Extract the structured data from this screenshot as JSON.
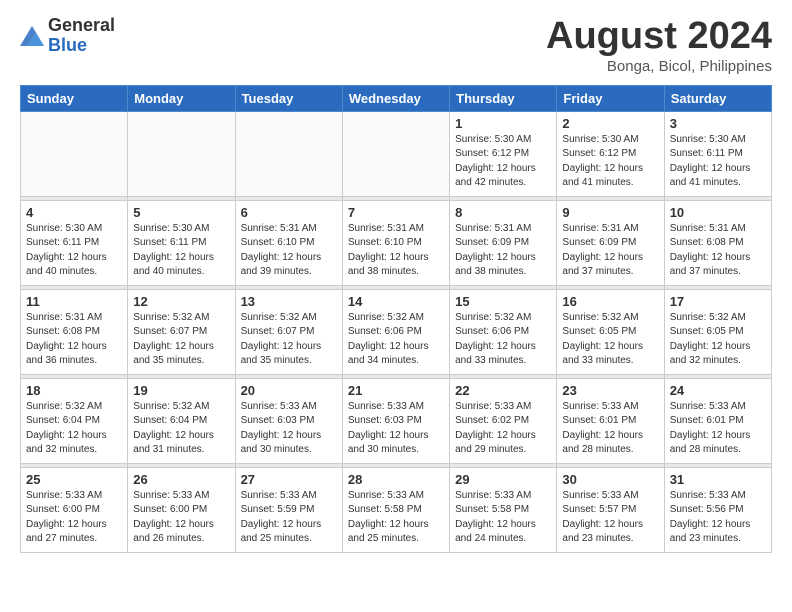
{
  "header": {
    "logo_general": "General",
    "logo_blue": "Blue",
    "month_year": "August 2024",
    "location": "Bonga, Bicol, Philippines"
  },
  "weekdays": [
    "Sunday",
    "Monday",
    "Tuesday",
    "Wednesday",
    "Thursday",
    "Friday",
    "Saturday"
  ],
  "weeks": [
    [
      {
        "day": "",
        "info": ""
      },
      {
        "day": "",
        "info": ""
      },
      {
        "day": "",
        "info": ""
      },
      {
        "day": "",
        "info": ""
      },
      {
        "day": "1",
        "info": "Sunrise: 5:30 AM\nSunset: 6:12 PM\nDaylight: 12 hours\nand 42 minutes."
      },
      {
        "day": "2",
        "info": "Sunrise: 5:30 AM\nSunset: 6:12 PM\nDaylight: 12 hours\nand 41 minutes."
      },
      {
        "day": "3",
        "info": "Sunrise: 5:30 AM\nSunset: 6:11 PM\nDaylight: 12 hours\nand 41 minutes."
      }
    ],
    [
      {
        "day": "4",
        "info": "Sunrise: 5:30 AM\nSunset: 6:11 PM\nDaylight: 12 hours\nand 40 minutes."
      },
      {
        "day": "5",
        "info": "Sunrise: 5:30 AM\nSunset: 6:11 PM\nDaylight: 12 hours\nand 40 minutes."
      },
      {
        "day": "6",
        "info": "Sunrise: 5:31 AM\nSunset: 6:10 PM\nDaylight: 12 hours\nand 39 minutes."
      },
      {
        "day": "7",
        "info": "Sunrise: 5:31 AM\nSunset: 6:10 PM\nDaylight: 12 hours\nand 38 minutes."
      },
      {
        "day": "8",
        "info": "Sunrise: 5:31 AM\nSunset: 6:09 PM\nDaylight: 12 hours\nand 38 minutes."
      },
      {
        "day": "9",
        "info": "Sunrise: 5:31 AM\nSunset: 6:09 PM\nDaylight: 12 hours\nand 37 minutes."
      },
      {
        "day": "10",
        "info": "Sunrise: 5:31 AM\nSunset: 6:08 PM\nDaylight: 12 hours\nand 37 minutes."
      }
    ],
    [
      {
        "day": "11",
        "info": "Sunrise: 5:31 AM\nSunset: 6:08 PM\nDaylight: 12 hours\nand 36 minutes."
      },
      {
        "day": "12",
        "info": "Sunrise: 5:32 AM\nSunset: 6:07 PM\nDaylight: 12 hours\nand 35 minutes."
      },
      {
        "day": "13",
        "info": "Sunrise: 5:32 AM\nSunset: 6:07 PM\nDaylight: 12 hours\nand 35 minutes."
      },
      {
        "day": "14",
        "info": "Sunrise: 5:32 AM\nSunset: 6:06 PM\nDaylight: 12 hours\nand 34 minutes."
      },
      {
        "day": "15",
        "info": "Sunrise: 5:32 AM\nSunset: 6:06 PM\nDaylight: 12 hours\nand 33 minutes."
      },
      {
        "day": "16",
        "info": "Sunrise: 5:32 AM\nSunset: 6:05 PM\nDaylight: 12 hours\nand 33 minutes."
      },
      {
        "day": "17",
        "info": "Sunrise: 5:32 AM\nSunset: 6:05 PM\nDaylight: 12 hours\nand 32 minutes."
      }
    ],
    [
      {
        "day": "18",
        "info": "Sunrise: 5:32 AM\nSunset: 6:04 PM\nDaylight: 12 hours\nand 32 minutes."
      },
      {
        "day": "19",
        "info": "Sunrise: 5:32 AM\nSunset: 6:04 PM\nDaylight: 12 hours\nand 31 minutes."
      },
      {
        "day": "20",
        "info": "Sunrise: 5:33 AM\nSunset: 6:03 PM\nDaylight: 12 hours\nand 30 minutes."
      },
      {
        "day": "21",
        "info": "Sunrise: 5:33 AM\nSunset: 6:03 PM\nDaylight: 12 hours\nand 30 minutes."
      },
      {
        "day": "22",
        "info": "Sunrise: 5:33 AM\nSunset: 6:02 PM\nDaylight: 12 hours\nand 29 minutes."
      },
      {
        "day": "23",
        "info": "Sunrise: 5:33 AM\nSunset: 6:01 PM\nDaylight: 12 hours\nand 28 minutes."
      },
      {
        "day": "24",
        "info": "Sunrise: 5:33 AM\nSunset: 6:01 PM\nDaylight: 12 hours\nand 28 minutes."
      }
    ],
    [
      {
        "day": "25",
        "info": "Sunrise: 5:33 AM\nSunset: 6:00 PM\nDaylight: 12 hours\nand 27 minutes."
      },
      {
        "day": "26",
        "info": "Sunrise: 5:33 AM\nSunset: 6:00 PM\nDaylight: 12 hours\nand 26 minutes."
      },
      {
        "day": "27",
        "info": "Sunrise: 5:33 AM\nSunset: 5:59 PM\nDaylight: 12 hours\nand 25 minutes."
      },
      {
        "day": "28",
        "info": "Sunrise: 5:33 AM\nSunset: 5:58 PM\nDaylight: 12 hours\nand 25 minutes."
      },
      {
        "day": "29",
        "info": "Sunrise: 5:33 AM\nSunset: 5:58 PM\nDaylight: 12 hours\nand 24 minutes."
      },
      {
        "day": "30",
        "info": "Sunrise: 5:33 AM\nSunset: 5:57 PM\nDaylight: 12 hours\nand 23 minutes."
      },
      {
        "day": "31",
        "info": "Sunrise: 5:33 AM\nSunset: 5:56 PM\nDaylight: 12 hours\nand 23 minutes."
      }
    ]
  ]
}
